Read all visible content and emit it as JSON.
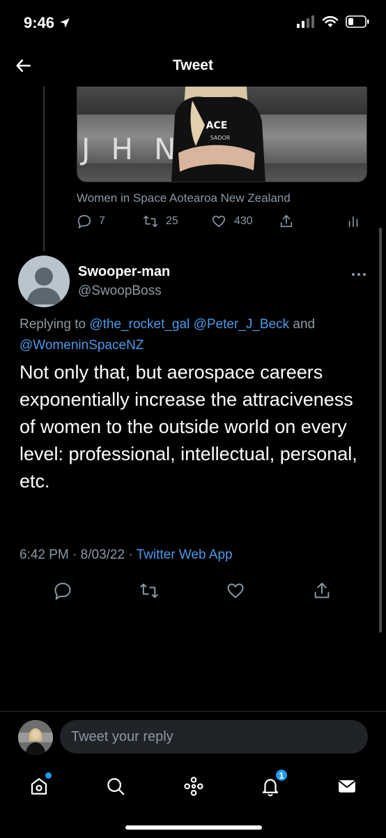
{
  "status_bar": {
    "time": "9:46"
  },
  "header": {
    "title": "Tweet"
  },
  "quoted": {
    "caption": "Women in Space Aotearoa New Zealand",
    "reply_count": "7",
    "retweet_count": "25",
    "like_count": "430",
    "media_shirt_text": "ACE",
    "media_shirt_subtext": "SADOR",
    "media_letters": "JHNЯM"
  },
  "tweet": {
    "display_name": "Swooper-man",
    "handle": "@SwoopBoss",
    "replying_prefix": "Replying to",
    "mentions": [
      "@the_rocket_gal",
      "@Peter_J_Beck"
    ],
    "replying_and": "and",
    "mention_last": "@WomeninSpaceNZ",
    "text": "Not only that, but aerospace careers exponentially increase the attraciveness of women to the outside world on every level: professional, intellectual, personal, etc.",
    "time": "6:42 PM",
    "date": "8/03/22",
    "separator": "·",
    "app": "Twitter Web App"
  },
  "composer": {
    "placeholder": "Tweet your reply"
  },
  "nav": {
    "notifications_badge": "1"
  },
  "colors": {
    "accent": "#1d9bf0",
    "link": "#4a99e9",
    "muted": "#8b98a5",
    "background": "#000000"
  }
}
